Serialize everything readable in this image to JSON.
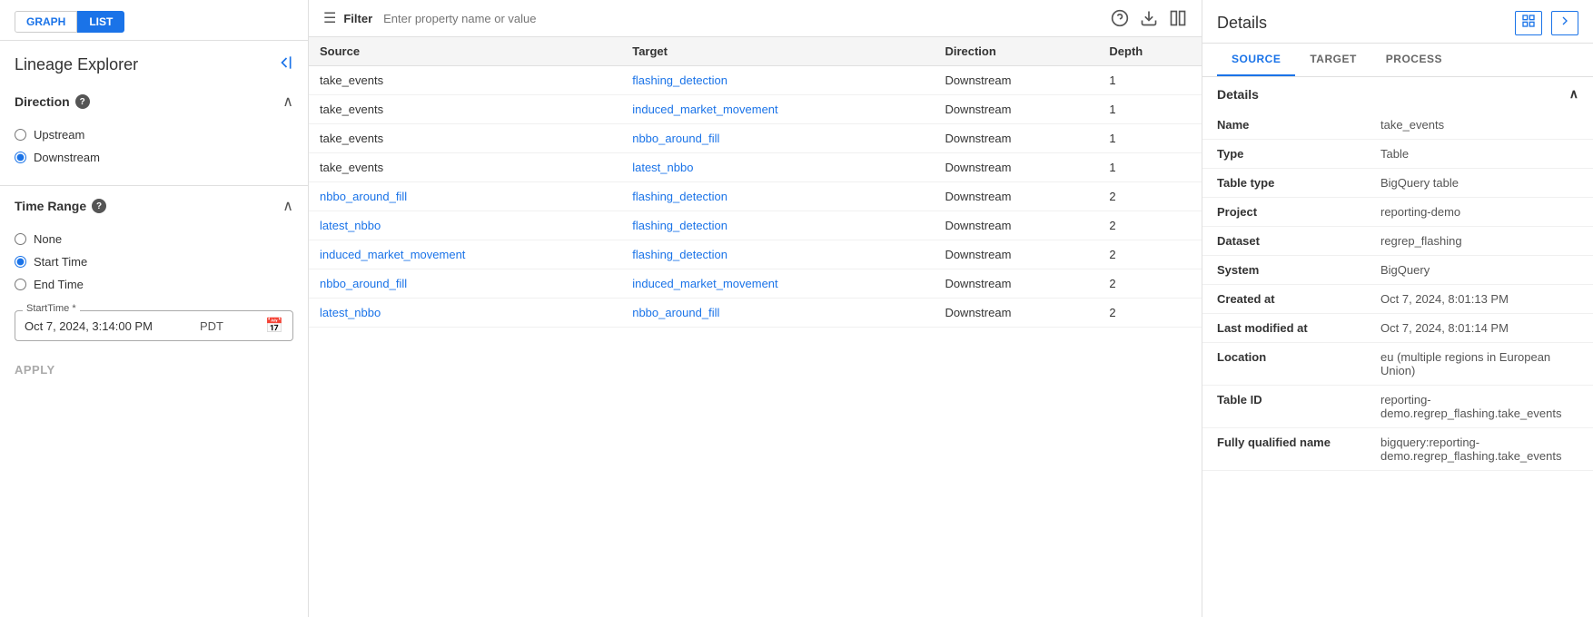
{
  "topTabs": {
    "graph": "GRAPH",
    "list": "LIST",
    "activeTab": "list"
  },
  "leftPanel": {
    "title": "Lineage Explorer",
    "collapseIcon": "◀",
    "direction": {
      "label": "Direction",
      "hasInfo": true,
      "options": [
        {
          "label": "Upstream",
          "value": "upstream",
          "selected": false
        },
        {
          "label": "Downstream",
          "value": "downstream",
          "selected": true
        }
      ]
    },
    "timeRange": {
      "label": "Time Range",
      "hasInfo": true,
      "options": [
        {
          "label": "None",
          "value": "none",
          "selected": false
        },
        {
          "label": "Start Time",
          "value": "start",
          "selected": true
        },
        {
          "label": "End Time",
          "value": "end",
          "selected": false
        }
      ]
    },
    "startTime": {
      "label": "StartTime *",
      "value": "Oct 7, 2024, 3:14:00 PM",
      "timezone": "PDT"
    },
    "applyBtn": "APPLY"
  },
  "filterBar": {
    "filterLabel": "Filter",
    "placeholder": "Enter property name or value"
  },
  "table": {
    "columns": [
      "Source",
      "Target",
      "Direction",
      "Depth"
    ],
    "rows": [
      {
        "source": "take_events",
        "sourceLink": false,
        "target": "flashing_detection",
        "targetLink": true,
        "direction": "Downstream",
        "depth": 1
      },
      {
        "source": "take_events",
        "sourceLink": false,
        "target": "induced_market_movement",
        "targetLink": true,
        "direction": "Downstream",
        "depth": 1
      },
      {
        "source": "take_events",
        "sourceLink": false,
        "target": "nbbo_around_fill",
        "targetLink": true,
        "direction": "Downstream",
        "depth": 1
      },
      {
        "source": "take_events",
        "sourceLink": false,
        "target": "latest_nbbo",
        "targetLink": true,
        "direction": "Downstream",
        "depth": 1
      },
      {
        "source": "nbbo_around_fill",
        "sourceLink": true,
        "target": "flashing_detection",
        "targetLink": true,
        "direction": "Downstream",
        "depth": 2
      },
      {
        "source": "latest_nbbo",
        "sourceLink": true,
        "target": "flashing_detection",
        "targetLink": true,
        "direction": "Downstream",
        "depth": 2
      },
      {
        "source": "induced_market_movement",
        "sourceLink": true,
        "target": "flashing_detection",
        "targetLink": true,
        "direction": "Downstream",
        "depth": 2
      },
      {
        "source": "nbbo_around_fill",
        "sourceLink": true,
        "target": "induced_market_movement",
        "targetLink": true,
        "direction": "Downstream",
        "depth": 2
      },
      {
        "source": "latest_nbbo",
        "sourceLink": true,
        "target": "nbbo_around_fill",
        "targetLink": true,
        "direction": "Downstream",
        "depth": 2
      }
    ]
  },
  "rightPanel": {
    "title": "Details",
    "tabs": [
      "SOURCE",
      "TARGET",
      "PROCESS"
    ],
    "activeTab": "SOURCE",
    "detailsSection": {
      "label": "Details",
      "fields": [
        {
          "key": "Name",
          "value": "take_events"
        },
        {
          "key": "Type",
          "value": "Table"
        },
        {
          "key": "Table type",
          "value": "BigQuery table"
        },
        {
          "key": "Project",
          "value": "reporting-demo"
        },
        {
          "key": "Dataset",
          "value": "regrep_flashing"
        },
        {
          "key": "System",
          "value": "BigQuery"
        },
        {
          "key": "Created at",
          "value": "Oct 7, 2024, 8:01:13 PM"
        },
        {
          "key": "Last modified at",
          "value": "Oct 7, 2024, 8:01:14 PM"
        },
        {
          "key": "Location",
          "value": "eu (multiple regions in European Union)"
        },
        {
          "key": "Table ID",
          "value": "reporting-demo.regrep_flashing.take_events"
        },
        {
          "key": "Fully qualified name",
          "value": "bigquery:reporting-demo.regrep_flashing.take_events"
        }
      ]
    }
  }
}
